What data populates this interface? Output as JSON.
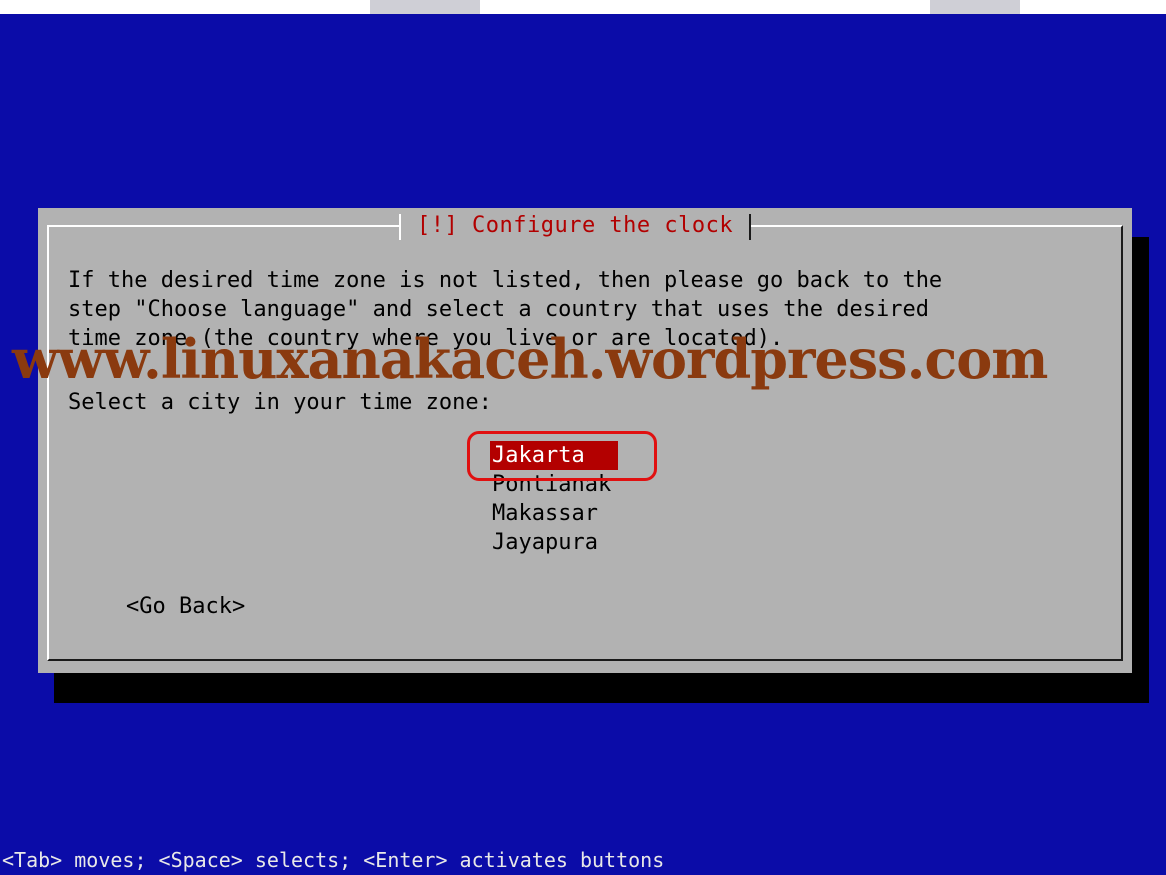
{
  "dialog": {
    "title": "[!] Configure the clock",
    "description_lines": [
      "If the desired time zone is not listed, then please go back to the",
      "step \"Choose language\" and select a country that uses the desired",
      "time zone (the country where you live or are located)."
    ],
    "prompt": "Select a city in your time zone:",
    "cities": [
      "Jakarta",
      "Pontianak",
      "Makassar",
      "Jayapura"
    ],
    "selected_city": "Jakarta",
    "go_back_label": "<Go Back>"
  },
  "watermark": "www.linuxanakaceh.wordpress.com",
  "statusbar": "<Tab> moves; <Space> selects; <Enter> activates buttons",
  "colors": {
    "screen_bg": "#0b0ca8",
    "dialog_bg": "#b2b2b2",
    "title": "#b20000",
    "selection": "#b30000",
    "highlight_ring": "#e01010",
    "watermark": "#8a3a0f"
  }
}
